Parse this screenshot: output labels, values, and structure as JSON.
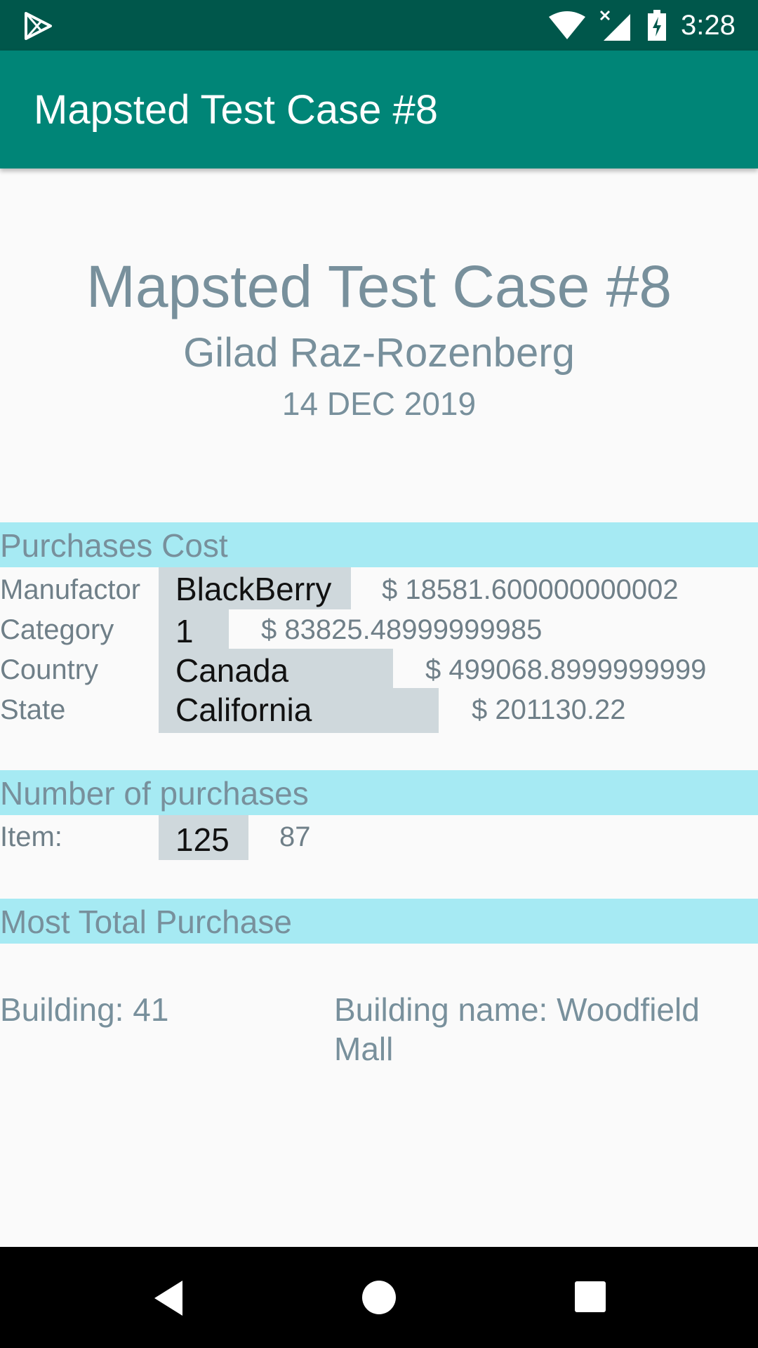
{
  "status_bar": {
    "time": "3:28",
    "icons": [
      "play-store-icon",
      "wifi-icon",
      "signal-icon",
      "battery-icon"
    ]
  },
  "app_bar": {
    "title": "Mapsted Test Case #8"
  },
  "header": {
    "title": "Mapsted Test Case #8",
    "author": "Gilad Raz-Rozenberg",
    "date": "14 DEC 2019"
  },
  "purchases_cost": {
    "title": "Purchases Cost",
    "rows": [
      {
        "label": "Manufactor",
        "value": "BlackBerry",
        "amount": "$ 18581.600000000002"
      },
      {
        "label": "Category",
        "value": "1",
        "amount": "$ 83825.48999999985"
      },
      {
        "label": "Country",
        "value": "Canada",
        "amount": "$ 499068.8999999999"
      },
      {
        "label": "State",
        "value": "California",
        "amount": "$ 201130.22"
      }
    ]
  },
  "number_of_purchases": {
    "title": "Number of purchases",
    "label": "Item:",
    "value": "125",
    "count": "87"
  },
  "most_total_purchase": {
    "title": "Most Total Purchase",
    "building": "Building: 41",
    "building_name": "Building name: Woodfield Mall"
  },
  "colors": {
    "status_bar": "#00574b",
    "app_bar": "#008577",
    "section_header": "#a6eaf3",
    "value_box": "#cfd8dc",
    "text_muted": "#78909c"
  },
  "nav_bar": {
    "icons": [
      "back-icon",
      "home-icon",
      "recents-icon"
    ]
  }
}
